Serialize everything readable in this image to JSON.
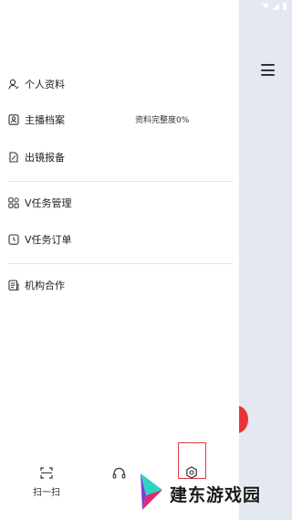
{
  "menu": {
    "items": [
      {
        "label": "个人资料",
        "icon": "user-icon"
      },
      {
        "label": "主播档案",
        "icon": "profile-card-icon",
        "extra": "资料完整度0%"
      },
      {
        "label": "出镜报备",
        "icon": "report-doc-icon"
      },
      {
        "label": "V任务管理",
        "icon": "task-grid-icon"
      },
      {
        "label": "V任务订单",
        "icon": "task-order-icon"
      },
      {
        "label": "机构合作",
        "icon": "institution-icon"
      }
    ]
  },
  "bottom_bar": {
    "scan_label": "扫一扫",
    "support_icon": "headset-icon",
    "settings_icon": "settings-icon"
  },
  "watermark": {
    "text": "建东游戏园"
  },
  "colors": {
    "accent_red": "#e8333a",
    "background_right": "#e4e8f0"
  }
}
